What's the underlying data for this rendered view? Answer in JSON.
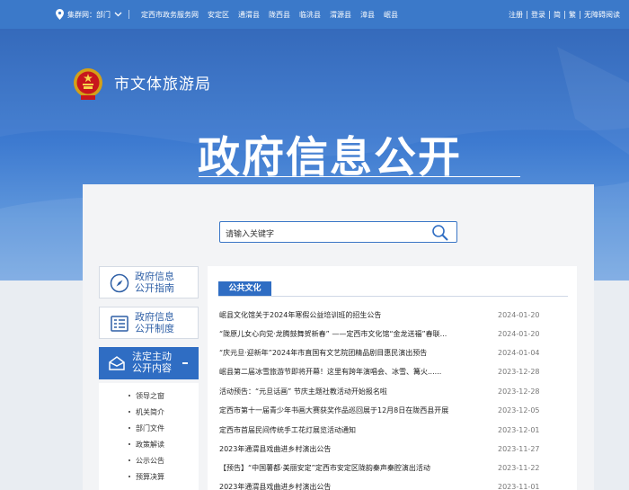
{
  "topbar": {
    "location": "集群网：部门",
    "links": [
      "定西市政务服务网",
      "安定区",
      "通渭县",
      "陇西县",
      "临洮县",
      "渭源县",
      "漳县",
      "岷县"
    ],
    "right": [
      "注册",
      "登录",
      "简",
      "繁",
      "无障碍阅读"
    ]
  },
  "banner": {
    "org_name": "市文体旅游局",
    "title": "政府信息公开"
  },
  "search": {
    "placeholder": "请输入关键字"
  },
  "menu": {
    "guide": [
      "政府信息",
      "公开指南"
    ],
    "system": [
      "政府信息",
      "公开制度"
    ],
    "active": [
      "法定主动",
      "公开内容"
    ],
    "sub_items": [
      "领导之窗",
      "机关简介",
      "部门文件",
      "政策解读",
      "公示公告",
      "预算决算"
    ]
  },
  "content": {
    "tab": "公共文化",
    "news": [
      {
        "title": "岷县文化馆关于2024年寒假公益培训班的招生公告",
        "date": "2024-01-20"
      },
      {
        "title": "“陇原儿女心向党·龙腾鼓舞贺新春” ——定西市文化馆“金龙送福”春联...",
        "date": "2024-01-20"
      },
      {
        "title": "“庆元旦·迎新年”2024年市直国有文艺院团精品剧目惠民演出预告",
        "date": "2024-01-04"
      },
      {
        "title": "岷县第二届冰雪旅游节即将开幕！这里有跨年演唱会、冰雪、篝火......",
        "date": "2023-12-28"
      },
      {
        "title": "活动预告：“元旦话画” 节庆主题社教活动开始报名啦",
        "date": "2023-12-28"
      },
      {
        "title": "定西市第十一届青少年书画大赛获奖作品巡回展于12月8日在陇西县开展",
        "date": "2023-12-05"
      },
      {
        "title": "定西市首届民间传统手工花灯展览活动通知",
        "date": "2023-12-01"
      },
      {
        "title": "2023年通渭县戏曲进乡村演出公告",
        "date": "2023-11-27"
      },
      {
        "title": "【预告】“中国薯都·美丽安定”定西市安定区陇韵秦声秦腔演出活动",
        "date": "2023-11-22"
      },
      {
        "title": "2023年通渭县戏曲进乡村演出公告",
        "date": "2023-11-01"
      }
    ]
  }
}
